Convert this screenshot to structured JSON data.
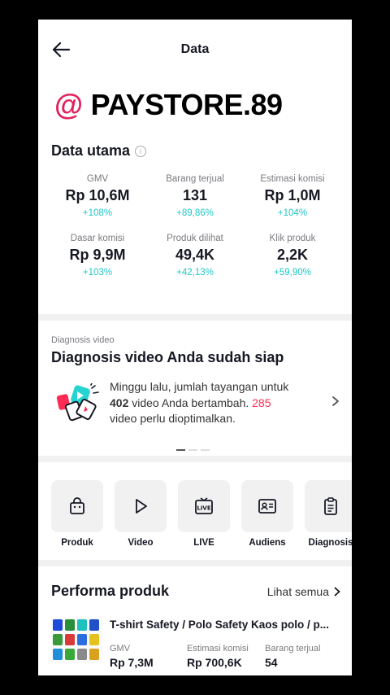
{
  "header": {
    "title": "Data"
  },
  "watermark": {
    "at": "@",
    "name": "PAYSTORE.89"
  },
  "main_data": {
    "title": "Data utama",
    "metrics": [
      {
        "label": "GMV",
        "value": "Rp 10,6M",
        "change": "+108%"
      },
      {
        "label": "Barang terjual",
        "value": "131",
        "change": "+89,86%"
      },
      {
        "label": "Estimasi komisi",
        "value": "Rp 1,0M",
        "change": "+104%"
      },
      {
        "label": "Dasar komisi",
        "value": "Rp 9,9M",
        "change": "+103%"
      },
      {
        "label": "Produk dilihat",
        "value": "49,4K",
        "change": "+42,13%"
      },
      {
        "label": "Klik produk",
        "value": "2,2K",
        "change": "+59,90%"
      }
    ]
  },
  "diagnosis": {
    "small_label": "Diagnosis video",
    "title": "Diagnosis video Anda sudah siap",
    "text_1": "Minggu lalu, jumlah tayangan untuk",
    "count_videos": "402",
    "text_2": " video Anda bertambah. ",
    "count_optimize": "285",
    "text_3": "video perlu dioptimalkan.",
    "accent_color": "#fe2c55"
  },
  "tools": [
    {
      "label": "Produk",
      "icon": "shopping-bag-icon"
    },
    {
      "label": "Video",
      "icon": "play-icon"
    },
    {
      "label": "LIVE",
      "icon": "live-tv-icon"
    },
    {
      "label": "Audiens",
      "icon": "audience-card-icon"
    },
    {
      "label": "Diagnosis",
      "icon": "clipboard-icon"
    }
  ],
  "performance": {
    "title": "Performa produk",
    "see_all": "Lihat semua",
    "product": {
      "name": "T-shirt Safety / Polo Safety Kaos polo / p...",
      "col_gmv": "GMV",
      "col_commission": "Estimasi komisi",
      "col_sold": "Barang terjual",
      "val_gmv": "Rp 7,3M",
      "val_commission": "Rp 700,6K",
      "val_sold": "54"
    }
  },
  "colors": {
    "positive_change": "#1fc7c7",
    "brand_pink": "#e0245e"
  }
}
